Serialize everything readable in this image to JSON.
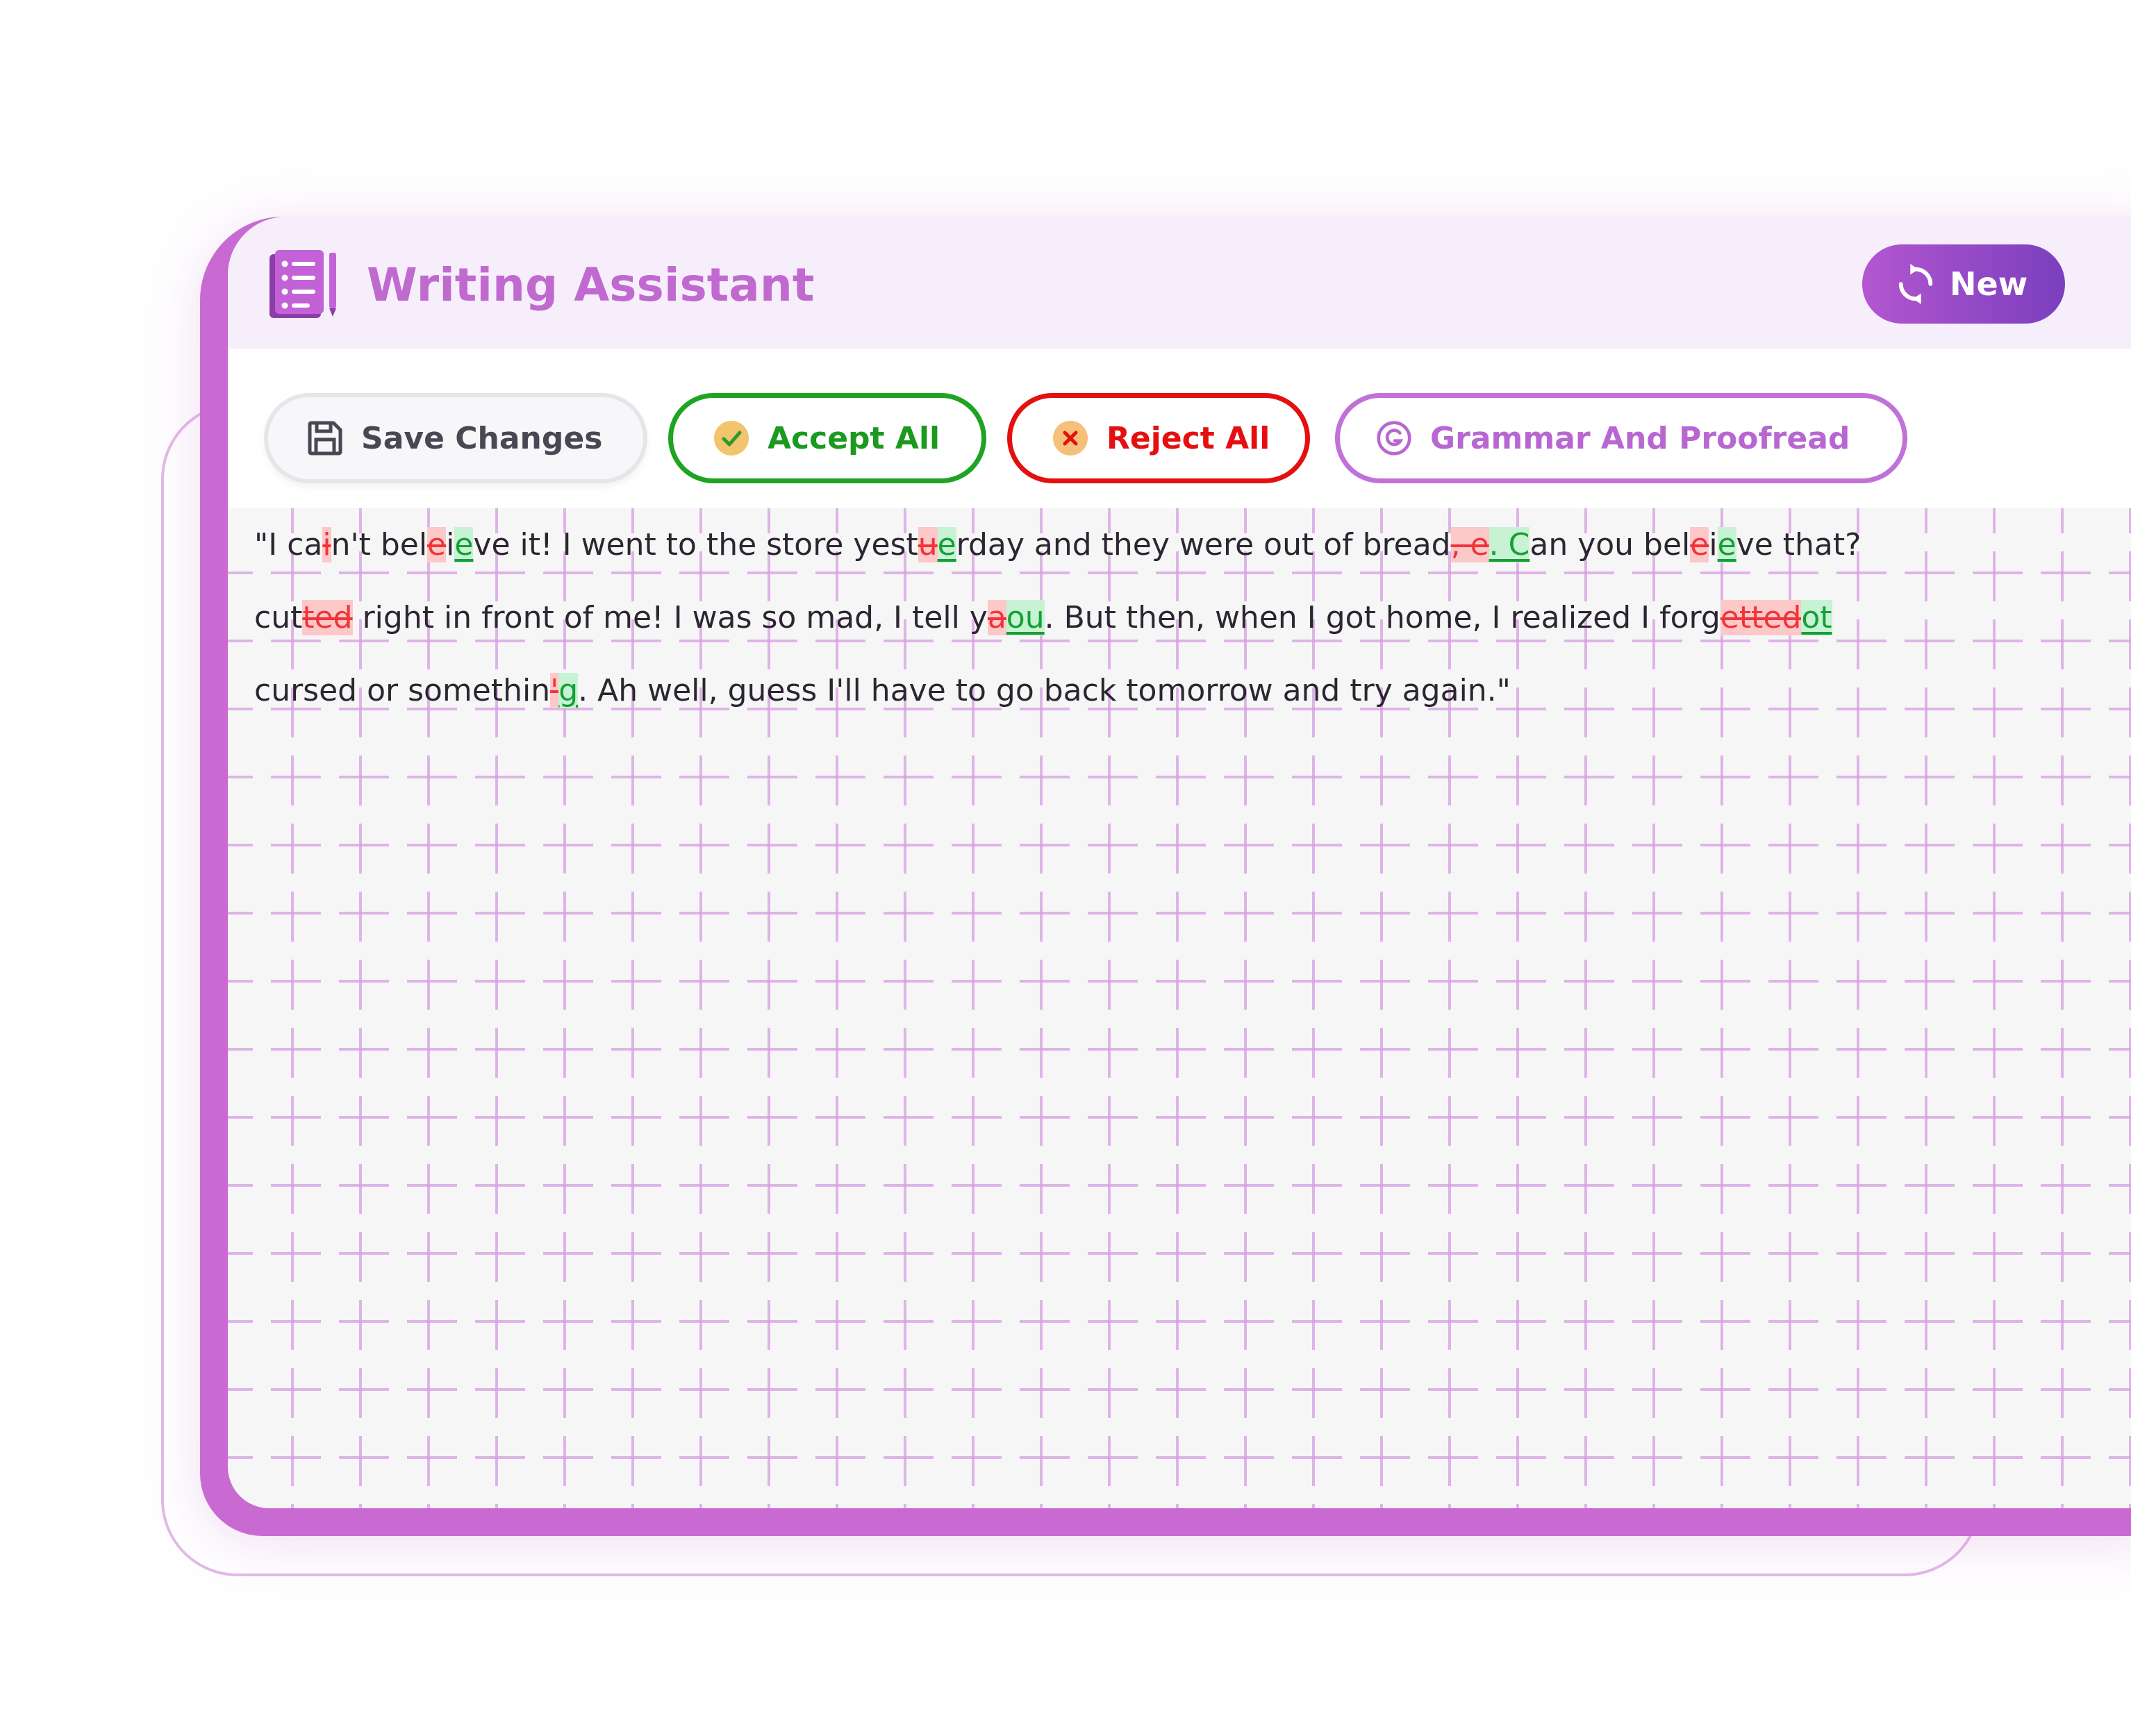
{
  "header": {
    "title": "Writing Assistant",
    "new_label": "New"
  },
  "toolbar": {
    "save_label": "Save Changes",
    "accept_label": "Accept All",
    "reject_label": "Reject All",
    "grammar_label": "Grammar And Proofread"
  },
  "editor": {
    "lines": [
      [
        {
          "t": "\"I ca",
          "k": "plain"
        },
        {
          "t": "i",
          "k": "del"
        },
        {
          "t": "n't bel",
          "k": "plain"
        },
        {
          "t": "e",
          "k": "del"
        },
        {
          "t": "i",
          "k": "plain"
        },
        {
          "t": "e",
          "k": "ins"
        },
        {
          "t": "ve it! I went to the store yest",
          "k": "plain"
        },
        {
          "t": "u",
          "k": "del"
        },
        {
          "t": "e",
          "k": "ins"
        },
        {
          "t": "rday and they were out of bread",
          "k": "plain"
        },
        {
          "t": ", e",
          "k": "del"
        },
        {
          "t": ". C",
          "k": "ins"
        },
        {
          "t": "an you bel",
          "k": "plain"
        },
        {
          "t": "e",
          "k": "del"
        },
        {
          "t": "i",
          "k": "plain"
        },
        {
          "t": "e",
          "k": "ins"
        },
        {
          "t": "ve that?",
          "k": "plain"
        }
      ],
      [
        {
          "t": "cut",
          "k": "plain"
        },
        {
          "t": "ted",
          "k": "del"
        },
        {
          "t": " right in front of me! I was so mad, I tell y",
          "k": "plain"
        },
        {
          "t": "a",
          "k": "del"
        },
        {
          "t": "ou",
          "k": "ins"
        },
        {
          "t": ". But then, when I got home, I realized I forg",
          "k": "plain"
        },
        {
          "t": "etted",
          "k": "del"
        },
        {
          "t": "ot",
          "k": "ins"
        }
      ],
      [
        {
          "t": "cursed or somethin",
          "k": "plain"
        },
        {
          "t": "'",
          "k": "del"
        },
        {
          "t": "g",
          "k": "ins"
        },
        {
          "t": ". Ah well, guess I'll have to go back tomorrow and try again.\"",
          "k": "plain"
        }
      ]
    ]
  },
  "colors": {
    "brand": "#c06ad0",
    "accept": "#1fa323",
    "reject": "#e41010",
    "insert": "#15a035",
    "delete": "#f0343a"
  },
  "icons": {
    "logo": "notebook-icon",
    "new": "refresh-icon",
    "save": "floppy-disk-icon",
    "accept": "check-circle-icon",
    "reject": "x-circle-icon",
    "grammar": "grammar-g-icon"
  }
}
